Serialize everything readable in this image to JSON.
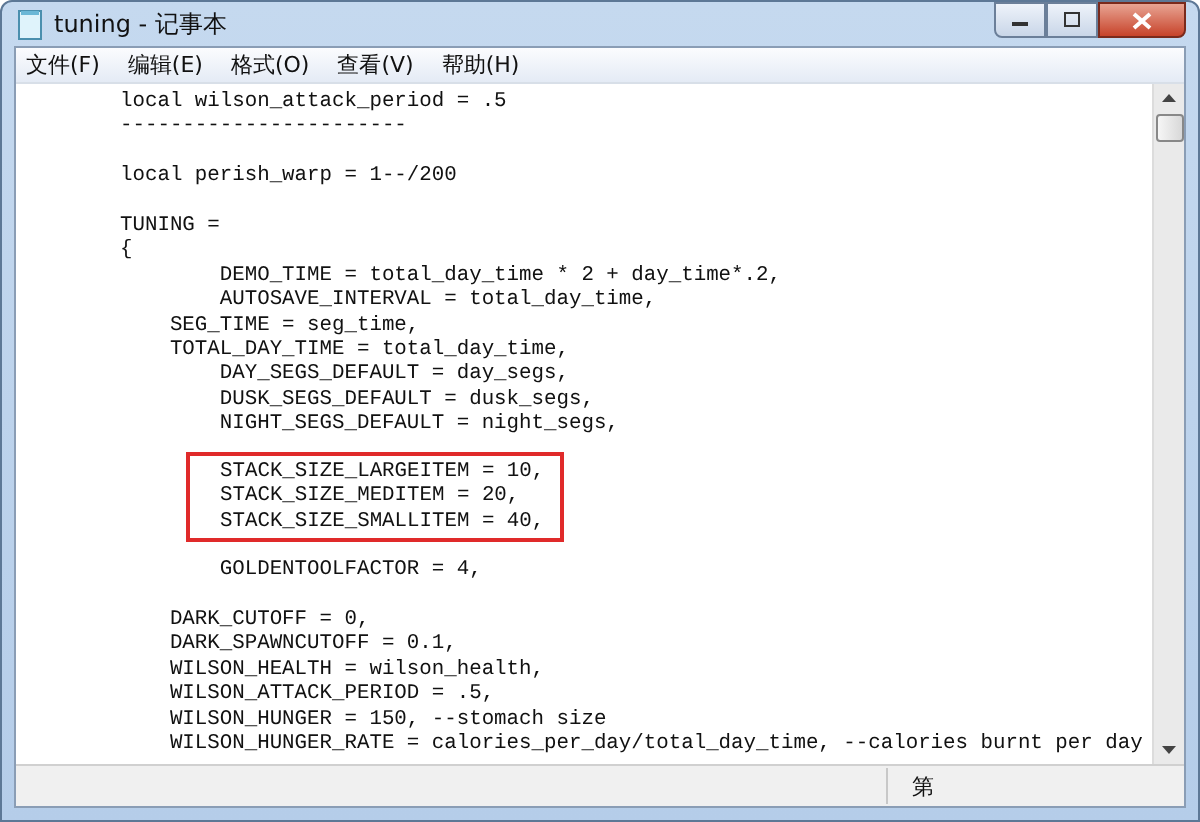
{
  "window": {
    "title": "tuning - 记事本"
  },
  "menu": [
    "文件(F)",
    "编辑(E)",
    "格式(O)",
    "查看(V)",
    "帮助(H)"
  ],
  "editor": {
    "blocks": [
      {
        "kind": "plain",
        "lines": [
          "local wilson_attack_period = .5",
          "-----------------------"
        ]
      },
      {
        "kind": "plain",
        "lines": [
          "local perish_warp = 1--/200"
        ]
      },
      {
        "kind": "plain",
        "lines": [
          "TUNING =",
          "{",
          "        DEMO_TIME = total_day_time * 2 + day_time*.2,",
          "        AUTOSAVE_INTERVAL = total_day_time,",
          "    SEG_TIME = seg_time,",
          "    TOTAL_DAY_TIME = total_day_time,",
          "        DAY_SEGS_DEFAULT = day_segs,",
          "        DUSK_SEGS_DEFAULT = dusk_segs,",
          "        NIGHT_SEGS_DEFAULT = night_segs,"
        ]
      },
      {
        "kind": "boxed",
        "lines": [
          "STACK_SIZE_LARGEITEM = 10,",
          "STACK_SIZE_MEDITEM = 20,",
          "STACK_SIZE_SMALLITEM = 40,"
        ]
      },
      {
        "kind": "plain",
        "lines": [
          "        GOLDENTOOLFACTOR = 4,"
        ]
      },
      {
        "kind": "plain",
        "lines": [
          "    DARK_CUTOFF = 0,",
          "    DARK_SPAWNCUTOFF = 0.1,",
          "    WILSON_HEALTH = wilson_health,",
          "    WILSON_ATTACK_PERIOD = .5,",
          "    WILSON_HUNGER = 150, --stomach size",
          "    WILSON_HUNGER_RATE = calories_per_day/total_day_time, --calories burnt per day"
        ]
      }
    ]
  },
  "status_bar": {
    "position": "第"
  }
}
